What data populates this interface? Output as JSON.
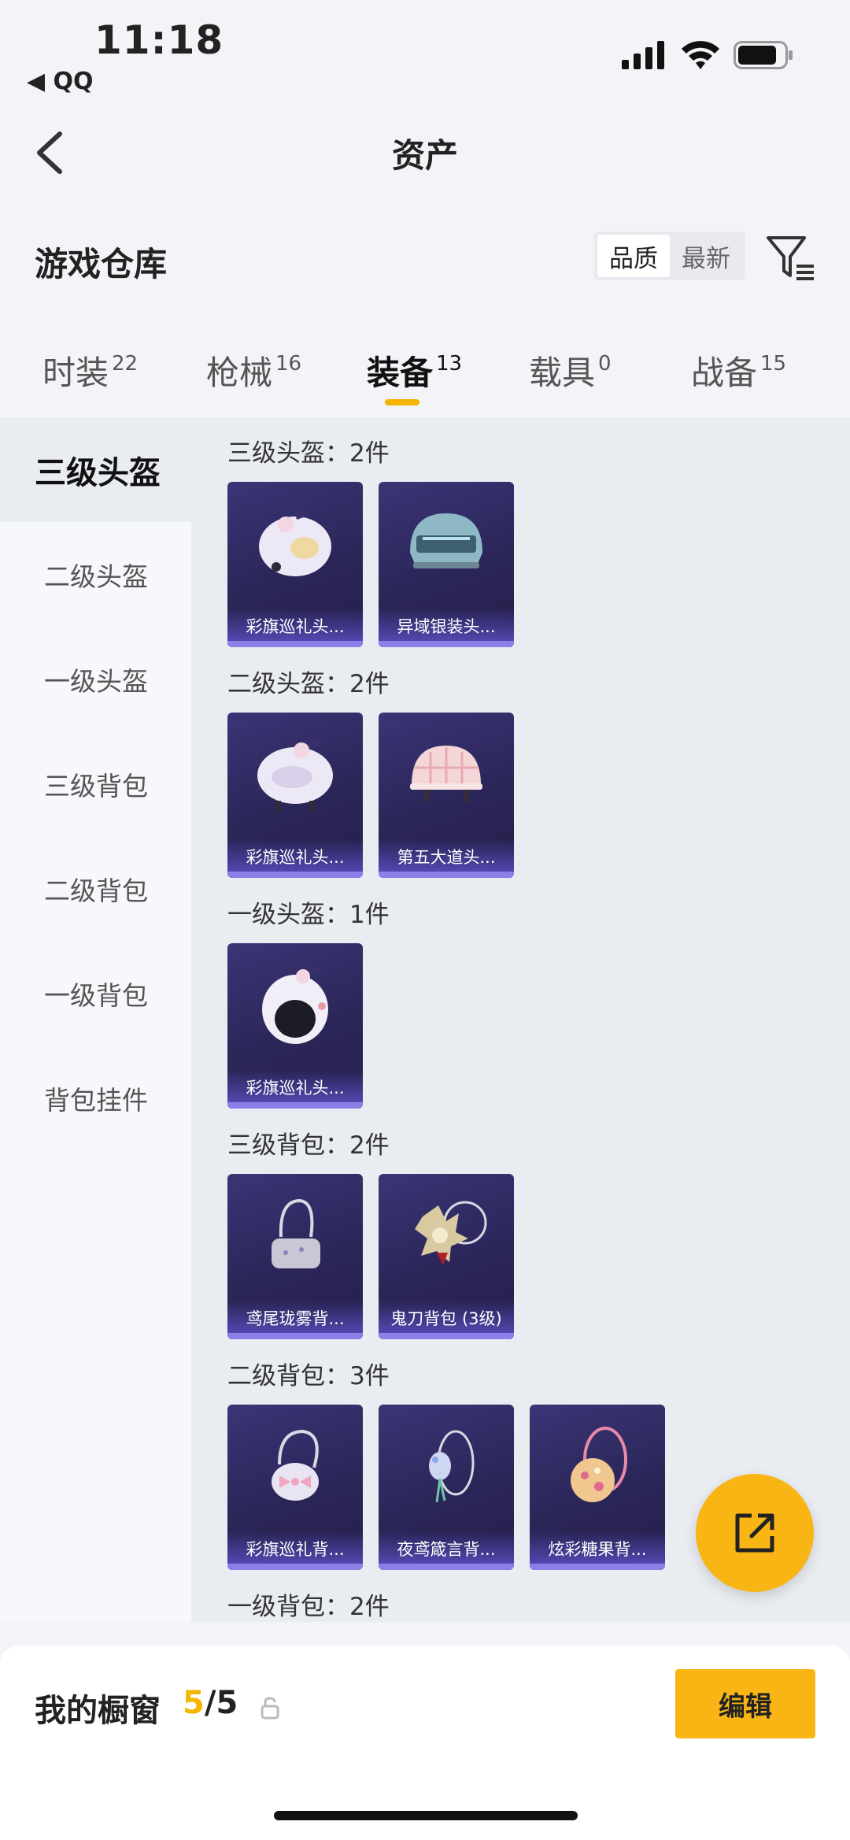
{
  "status": {
    "time": "11:18",
    "back_app": "◀ QQ"
  },
  "nav": {
    "title": "资产"
  },
  "section": {
    "title": "游戏仓库",
    "sort_options": [
      "品质",
      "最新"
    ]
  },
  "tabs": [
    {
      "label": "时装",
      "count": "22"
    },
    {
      "label": "枪械",
      "count": "16"
    },
    {
      "label": "装备",
      "count": "13"
    },
    {
      "label": "载具",
      "count": "0"
    },
    {
      "label": "战备",
      "count": "15"
    }
  ],
  "sidebar": [
    "三级头盔",
    "二级头盔",
    "一级头盔",
    "三级背包",
    "二级背包",
    "一级背包",
    "背包挂件"
  ],
  "groups": [
    {
      "title": "三级头盔：2件",
      "items": [
        "彩旗巡礼头...",
        "异域银装头..."
      ]
    },
    {
      "title": "二级头盔：2件",
      "items": [
        "彩旗巡礼头...",
        "第五大道头..."
      ]
    },
    {
      "title": "一级头盔：1件",
      "items": [
        "彩旗巡礼头..."
      ]
    },
    {
      "title": "三级背包：2件",
      "items": [
        "鸢尾珑雾背...",
        "鬼刀背包 (3级)"
      ]
    },
    {
      "title": "二级背包：3件",
      "items": [
        "彩旗巡礼背...",
        "夜鸢箴言背...",
        "炫彩糖果背..."
      ]
    },
    {
      "title": "一级背包：2件",
      "items": []
    }
  ],
  "bottom": {
    "label": "我的橱窗",
    "count_current": "5",
    "count_sep": "/5",
    "edit_label": "编辑"
  }
}
